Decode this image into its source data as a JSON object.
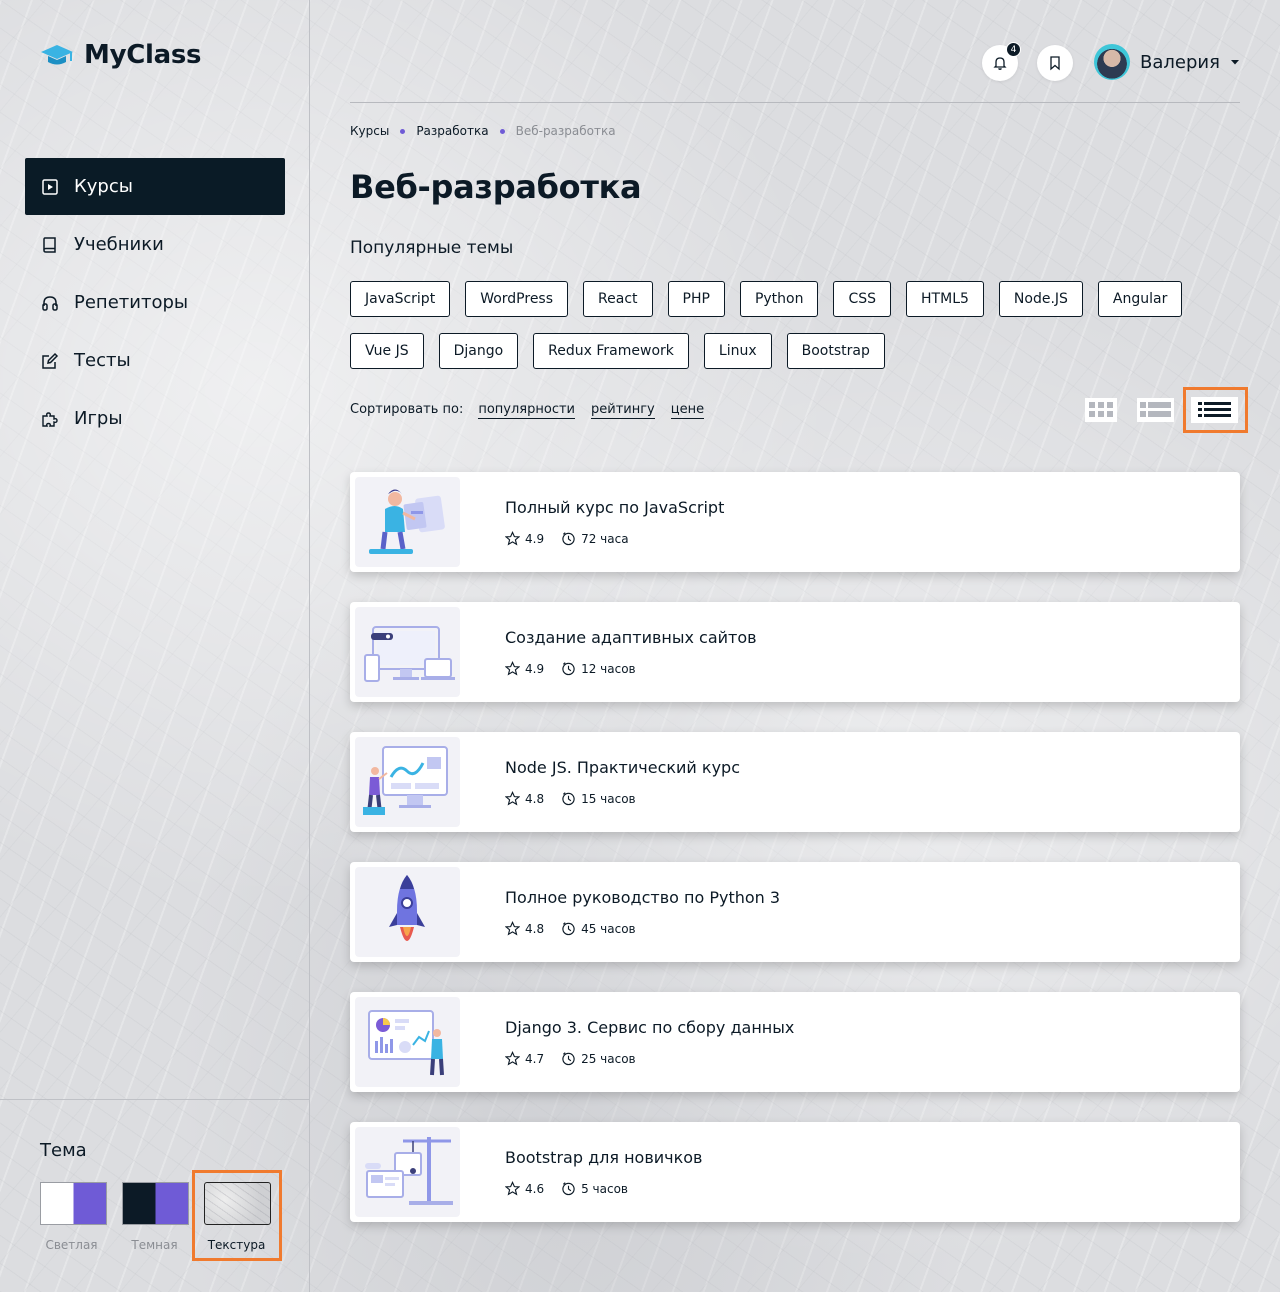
{
  "app": {
    "name": "MyClass"
  },
  "sidebar": {
    "items": [
      {
        "label": "Курсы",
        "icon": "play-square-icon",
        "active": true
      },
      {
        "label": "Учебники",
        "icon": "book-icon",
        "active": false
      },
      {
        "label": "Репетиторы",
        "icon": "headphones-icon",
        "active": false
      },
      {
        "label": "Тесты",
        "icon": "edit-icon",
        "active": false
      },
      {
        "label": "Игры",
        "icon": "puzzle-icon",
        "active": false
      }
    ],
    "theme": {
      "title": "Тема",
      "options": [
        {
          "label": "Светлая"
        },
        {
          "label": "Темная"
        },
        {
          "label": "Текстура",
          "selected": true
        }
      ]
    }
  },
  "header": {
    "notifications_count": "4",
    "user_name": "Валерия"
  },
  "breadcrumb": [
    "Курсы",
    "Разработка",
    "Веб-разработка"
  ],
  "page_title": "Веб-разработка",
  "popular": {
    "title": "Популярные темы",
    "tags": [
      "JavaScript",
      "WordPress",
      "React",
      "PHP",
      "Python",
      "CSS",
      "HTML5",
      "Node.JS",
      "Angular",
      "Vue JS",
      "Django",
      "Redux Framework",
      "Linux",
      "Bootstrap"
    ]
  },
  "sort": {
    "label": "Сортировать по:",
    "options": [
      "популярности",
      "рейтингу",
      "цене"
    ]
  },
  "view": {
    "selected": "compact-list"
  },
  "courses": [
    {
      "title": "Полный курс по JavaScript",
      "rating": "4.9",
      "duration": "72 часа",
      "image": "person-at-screen"
    },
    {
      "title": "Создание адаптивных сайтов",
      "rating": "4.9",
      "duration": "12 часов",
      "image": "responsive-devices"
    },
    {
      "title": "Node JS. Практический курс",
      "rating": "4.8",
      "duration": "15 часов",
      "image": "dashboard-presenter"
    },
    {
      "title": "Полное руководство по Python 3",
      "rating": "4.8",
      "duration": "45 часов",
      "image": "rocket"
    },
    {
      "title": "Django 3. Сервис по сбору данных",
      "rating": "4.7",
      "duration": "25 часов",
      "image": "analytics-board"
    },
    {
      "title": "Bootstrap для новичков",
      "rating": "4.6",
      "duration": "5 часов",
      "image": "construction-crane"
    }
  ],
  "colors": {
    "accent": "#6f5bd6",
    "dark": "#0c1a26",
    "highlight": "#f07a2e"
  }
}
